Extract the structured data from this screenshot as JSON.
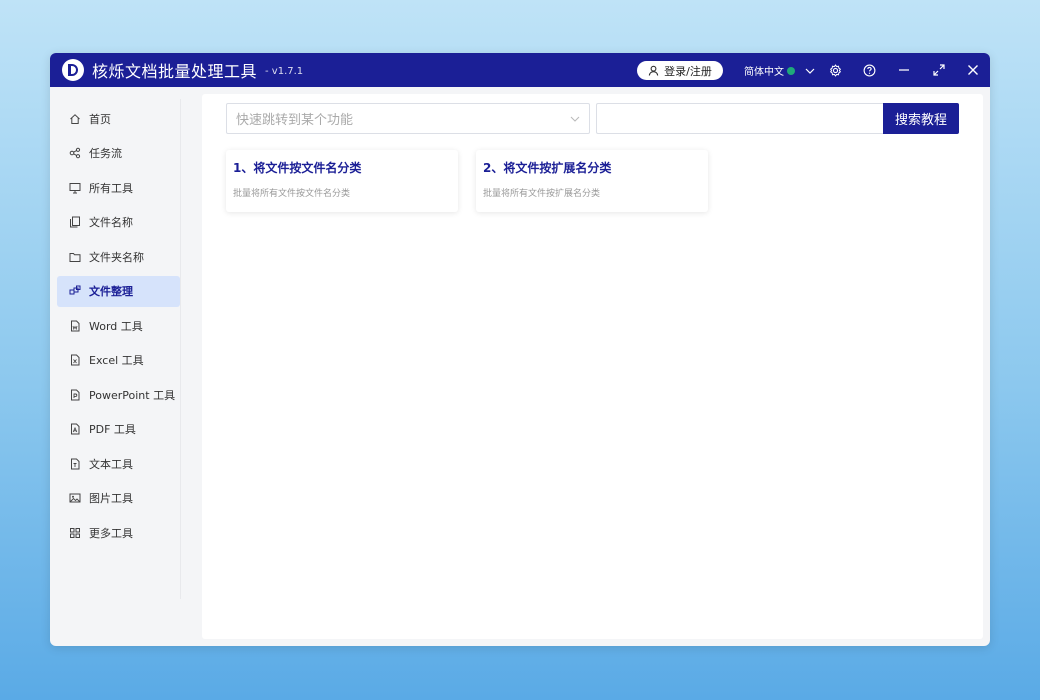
{
  "app": {
    "title": "核烁文档批量处理工具",
    "version": "- v1.7.1"
  },
  "header": {
    "login_label": "登录/注册",
    "language": "简体中文"
  },
  "sidebar": {
    "items": [
      {
        "label": "首页",
        "icon": "home-icon"
      },
      {
        "label": "任务流",
        "icon": "workflow-icon"
      },
      {
        "label": "所有工具",
        "icon": "monitor-icon"
      },
      {
        "label": "文件名称",
        "icon": "file-copy-icon"
      },
      {
        "label": "文件夹名称",
        "icon": "folder-icon"
      },
      {
        "label": "文件整理",
        "icon": "organize-icon",
        "active": true
      },
      {
        "label": "Word 工具",
        "icon": "word-file-icon"
      },
      {
        "label": "Excel 工具",
        "icon": "excel-file-icon"
      },
      {
        "label": "PowerPoint 工具",
        "icon": "ppt-file-icon"
      },
      {
        "label": "PDF 工具",
        "icon": "pdf-file-icon"
      },
      {
        "label": "文本工具",
        "icon": "text-file-icon"
      },
      {
        "label": "图片工具",
        "icon": "image-icon"
      },
      {
        "label": "更多工具",
        "icon": "grid-icon"
      }
    ]
  },
  "main": {
    "quick_jump_placeholder": "快速跳转到某个功能",
    "search_value": "",
    "search_button": "搜索教程",
    "cards": [
      {
        "title": "1、将文件按文件名分类",
        "desc": "批量将所有文件按文件名分类"
      },
      {
        "title": "2、将文件按扩展名分类",
        "desc": "批量将所有文件按扩展名分类"
      }
    ]
  },
  "colors": {
    "brand": "#1b1f96",
    "active_bg": "#d6e3fb"
  }
}
